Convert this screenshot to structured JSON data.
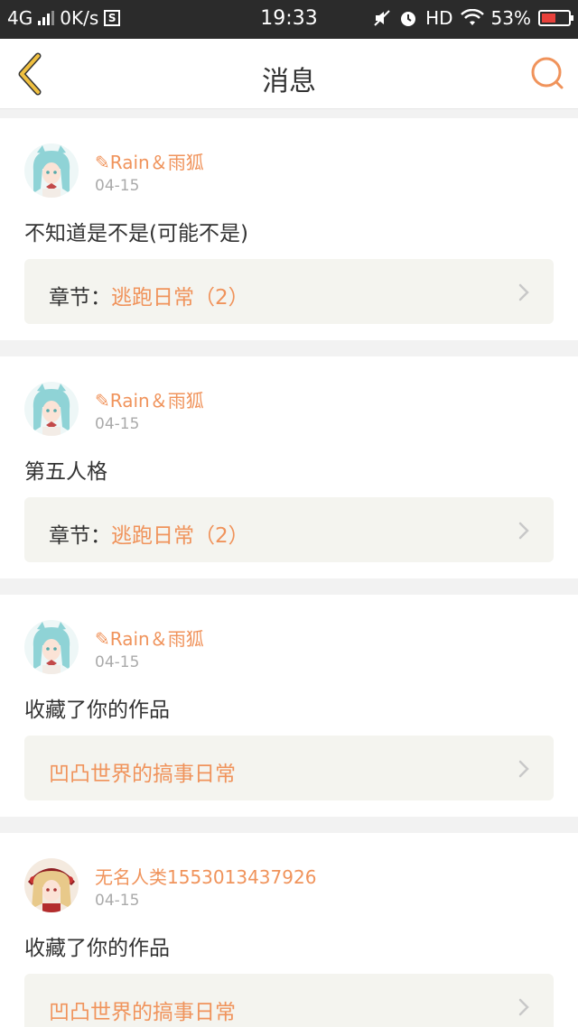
{
  "status_bar": {
    "network": "4G",
    "speed": "0K/s",
    "s_badge": "S",
    "time": "19:33",
    "hd": "HD",
    "battery_pct": "53%",
    "battery_level": 0.53
  },
  "header": {
    "title": "消息",
    "back_icon": "chevron-left-icon",
    "search_icon": "search-icon"
  },
  "colors": {
    "accent": "#f0935b",
    "back_icon": "#f0c040",
    "link_box_bg": "#f4f4ef"
  },
  "messages": [
    {
      "avatar": "avatar-cyan-hair",
      "user": "✎Rain＆雨狐",
      "date": "04-15",
      "content": "不知道是不是(可能不是)",
      "link_prefix": "章节：",
      "link_title": "逃跑日常（2）"
    },
    {
      "avatar": "avatar-cyan-hair",
      "user": "✎Rain＆雨狐",
      "date": "04-15",
      "content": "第五人格",
      "link_prefix": "章节：",
      "link_title": "逃跑日常（2）"
    },
    {
      "avatar": "avatar-cyan-hair",
      "user": "✎Rain＆雨狐",
      "date": "04-15",
      "content": "收藏了你的作品",
      "link_prefix": "",
      "link_title": "凹凸世界的搞事日常"
    },
    {
      "avatar": "avatar-blonde-hair",
      "user": "无名人类1553013437926",
      "date": "04-15",
      "content": "收藏了你的作品",
      "link_prefix": "",
      "link_title": "凹凸世界的搞事日常"
    }
  ]
}
